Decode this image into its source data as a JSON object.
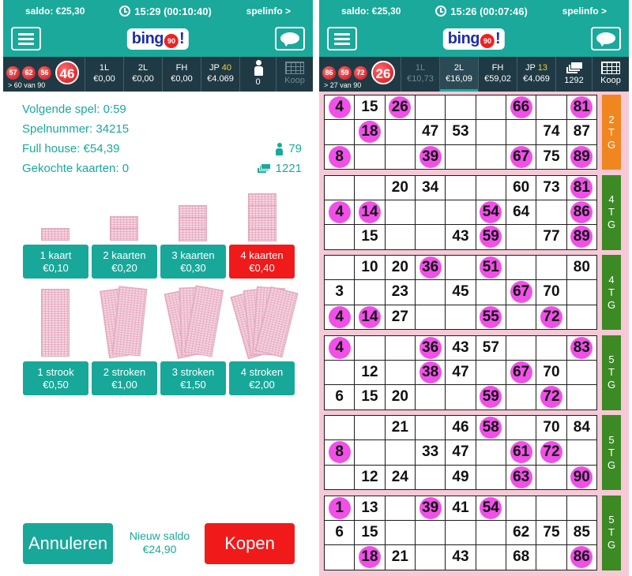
{
  "left": {
    "status": {
      "balance": "saldo: €25,30",
      "time": "15:29 (00:10:40)",
      "info": "spelinfo >"
    },
    "logo": {
      "text": "bing",
      "ball": "90",
      "suffix": "!"
    },
    "infobar": {
      "balls": [
        "57",
        "62",
        "56"
      ],
      "current_ball": "46",
      "count": "> 60 van 90",
      "prizes": [
        {
          "label": "1L",
          "value": "€0,00"
        },
        {
          "label": "2L",
          "value": "€0,00"
        },
        {
          "label": "FH",
          "value": "€0,00"
        },
        {
          "label": "JP",
          "jp_num": "40",
          "value": "€4.069"
        }
      ],
      "players": "0",
      "koop": "Koop"
    },
    "info": {
      "next_game": "Volgende spel: 0:59",
      "game_number": "Spelnummer: 34215",
      "full_house": "Full house: €54,39",
      "players_count": "79",
      "bought_cards": "Gekochte kaarten: 0",
      "cards_count": "1221"
    },
    "options": [
      {
        "label": "1 kaart",
        "price": "€0,10"
      },
      {
        "label": "2 kaarten",
        "price": "€0,20"
      },
      {
        "label": "3 kaarten",
        "price": "€0,30"
      },
      {
        "label": "4 kaarten",
        "price": "€0,40"
      },
      {
        "label": "1 strook",
        "price": "€0,50"
      },
      {
        "label": "2 stroken",
        "price": "€1,00"
      },
      {
        "label": "3 stroken",
        "price": "€1,50"
      },
      {
        "label": "4 stroken",
        "price": "€2,00"
      }
    ],
    "selected_option": 3,
    "cancel": "Annuleren",
    "new_balance_label": "Nieuw saldo",
    "new_balance_value": "€24,90",
    "buy": "Kopen"
  },
  "right": {
    "status": {
      "balance": "saldo: €25,30",
      "time": "15:26 (00:07:46)",
      "info": "spelinfo >"
    },
    "logo": {
      "text": "bing",
      "ball": "90",
      "suffix": "!"
    },
    "infobar": {
      "balls": [
        "86",
        "59",
        "72"
      ],
      "current_ball": "26",
      "count": "> 27 van 90",
      "prizes": [
        {
          "label": "1L",
          "value": "€10,73"
        },
        {
          "label": "2L",
          "value": "€16,09"
        },
        {
          "label": "FH",
          "value": "€59,02"
        },
        {
          "label": "JP",
          "jp_num": "13",
          "value": "€4.069"
        }
      ],
      "cards": "1292",
      "koop": "Koop"
    },
    "tickets": [
      {
        "tg": [
          "2",
          "T",
          "G"
        ],
        "tg_color": "orange",
        "rows": [
          [
            {
              "n": "4",
              "d": true
            },
            {
              "n": "15"
            },
            {
              "n": "26",
              "d": true
            },
            {
              "n": ""
            },
            {
              "n": ""
            },
            {
              "n": ""
            },
            {
              "n": "66",
              "d": true
            },
            {
              "n": ""
            },
            {
              "n": "81",
              "d": true
            }
          ],
          [
            {
              "n": ""
            },
            {
              "n": "18",
              "d": true
            },
            {
              "n": ""
            },
            {
              "n": "47"
            },
            {
              "n": "53"
            },
            {
              "n": ""
            },
            {
              "n": ""
            },
            {
              "n": "74"
            },
            {
              "n": "87"
            }
          ],
          [
            {
              "n": "8",
              "d": true
            },
            {
              "n": ""
            },
            {
              "n": ""
            },
            {
              "n": "39",
              "d": true
            },
            {
              "n": ""
            },
            {
              "n": ""
            },
            {
              "n": "67",
              "d": true
            },
            {
              "n": "75"
            },
            {
              "n": "89",
              "d": true
            }
          ]
        ]
      },
      {
        "tg": [
          "4",
          "T",
          "G"
        ],
        "tg_color": "green",
        "rows": [
          [
            {
              "n": ""
            },
            {
              "n": ""
            },
            {
              "n": "20"
            },
            {
              "n": "34"
            },
            {
              "n": ""
            },
            {
              "n": ""
            },
            {
              "n": "60"
            },
            {
              "n": "73"
            },
            {
              "n": "81",
              "d": true
            }
          ],
          [
            {
              "n": "4",
              "d": true
            },
            {
              "n": "14",
              "d": true
            },
            {
              "n": ""
            },
            {
              "n": ""
            },
            {
              "n": ""
            },
            {
              "n": "54",
              "d": true
            },
            {
              "n": "64"
            },
            {
              "n": ""
            },
            {
              "n": "86",
              "d": true
            }
          ],
          [
            {
              "n": ""
            },
            {
              "n": "15"
            },
            {
              "n": ""
            },
            {
              "n": ""
            },
            {
              "n": "43"
            },
            {
              "n": "59",
              "d": true
            },
            {
              "n": ""
            },
            {
              "n": "77"
            },
            {
              "n": "89",
              "d": true
            }
          ]
        ]
      },
      {
        "tg": [
          "4",
          "T",
          "G"
        ],
        "tg_color": "green",
        "rows": [
          [
            {
              "n": ""
            },
            {
              "n": "10"
            },
            {
              "n": "20"
            },
            {
              "n": "36",
              "d": true
            },
            {
              "n": ""
            },
            {
              "n": "51",
              "d": true
            },
            {
              "n": ""
            },
            {
              "n": ""
            },
            {
              "n": "80"
            }
          ],
          [
            {
              "n": "3"
            },
            {
              "n": ""
            },
            {
              "n": "23"
            },
            {
              "n": ""
            },
            {
              "n": "45"
            },
            {
              "n": ""
            },
            {
              "n": "67",
              "d": true
            },
            {
              "n": "70"
            },
            {
              "n": ""
            }
          ],
          [
            {
              "n": "4",
              "d": true
            },
            {
              "n": "14",
              "d": true
            },
            {
              "n": "27"
            },
            {
              "n": ""
            },
            {
              "n": ""
            },
            {
              "n": "55",
              "d": true
            },
            {
              "n": ""
            },
            {
              "n": "72",
              "d": true
            },
            {
              "n": ""
            }
          ]
        ]
      },
      {
        "tg": [
          "5",
          "T",
          "G"
        ],
        "tg_color": "green",
        "rows": [
          [
            {
              "n": "4",
              "d": true
            },
            {
              "n": ""
            },
            {
              "n": ""
            },
            {
              "n": "36",
              "d": true
            },
            {
              "n": "43"
            },
            {
              "n": "57"
            },
            {
              "n": ""
            },
            {
              "n": ""
            },
            {
              "n": "83",
              "d": true
            }
          ],
          [
            {
              "n": ""
            },
            {
              "n": "12"
            },
            {
              "n": ""
            },
            {
              "n": "38",
              "d": true
            },
            {
              "n": "47"
            },
            {
              "n": ""
            },
            {
              "n": "67",
              "d": true
            },
            {
              "n": "70"
            },
            {
              "n": ""
            }
          ],
          [
            {
              "n": "6"
            },
            {
              "n": "15"
            },
            {
              "n": "20"
            },
            {
              "n": ""
            },
            {
              "n": ""
            },
            {
              "n": "59",
              "d": true
            },
            {
              "n": ""
            },
            {
              "n": "72",
              "d": true
            },
            {
              "n": ""
            }
          ]
        ]
      },
      {
        "tg": [
          "5",
          "T",
          "G"
        ],
        "tg_color": "green",
        "rows": [
          [
            {
              "n": ""
            },
            {
              "n": ""
            },
            {
              "n": "21"
            },
            {
              "n": ""
            },
            {
              "n": "46"
            },
            {
              "n": "58",
              "d": true
            },
            {
              "n": ""
            },
            {
              "n": "70"
            },
            {
              "n": "84"
            }
          ],
          [
            {
              "n": "8",
              "d": true
            },
            {
              "n": ""
            },
            {
              "n": ""
            },
            {
              "n": "33"
            },
            {
              "n": "47"
            },
            {
              "n": ""
            },
            {
              "n": "61",
              "d": true
            },
            {
              "n": "72",
              "d": true
            },
            {
              "n": ""
            }
          ],
          [
            {
              "n": ""
            },
            {
              "n": "12"
            },
            {
              "n": "24"
            },
            {
              "n": ""
            },
            {
              "n": "49"
            },
            {
              "n": ""
            },
            {
              "n": "63",
              "d": true
            },
            {
              "n": ""
            },
            {
              "n": "90",
              "d": true
            }
          ]
        ]
      },
      {
        "tg": [
          "5",
          "T",
          "G"
        ],
        "tg_color": "green",
        "rows": [
          [
            {
              "n": "1",
              "d": true
            },
            {
              "n": "13"
            },
            {
              "n": ""
            },
            {
              "n": "39",
              "d": true
            },
            {
              "n": "41"
            },
            {
              "n": "54",
              "d": true
            },
            {
              "n": ""
            },
            {
              "n": ""
            },
            {
              "n": ""
            }
          ],
          [
            {
              "n": "6"
            },
            {
              "n": "15"
            },
            {
              "n": ""
            },
            {
              "n": ""
            },
            {
              "n": ""
            },
            {
              "n": ""
            },
            {
              "n": "62"
            },
            {
              "n": "75"
            },
            {
              "n": "85"
            }
          ],
          [
            {
              "n": ""
            },
            {
              "n": "18",
              "d": true
            },
            {
              "n": "21"
            },
            {
              "n": ""
            },
            {
              "n": "43"
            },
            {
              "n": ""
            },
            {
              "n": "68"
            },
            {
              "n": ""
            },
            {
              "n": "86",
              "d": true
            }
          ]
        ]
      }
    ]
  },
  "colors": {
    "teal": "#1aa99a",
    "dark": "#1f3a44",
    "red": "#f01a1a",
    "dab": "#f050e8",
    "ticket_bg": "#f7c9d6",
    "tg_orange": "#f08620",
    "tg_green": "#3c8a24"
  }
}
